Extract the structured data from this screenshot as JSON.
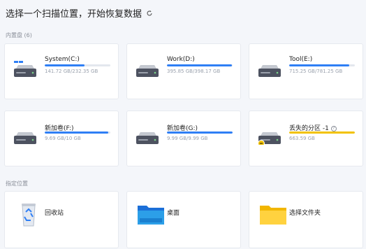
{
  "header": {
    "title": "选择一个扫描位置，开始恢复数据",
    "refresh_icon": "refresh-icon"
  },
  "sections": {
    "drives_label": "内置盘",
    "drives_count": "(6)",
    "locations_label": "指定位置"
  },
  "colors": {
    "accent": "#2f7ff5",
    "lost_partition": "#f2c200",
    "bar_track": "#e3e7ee"
  },
  "drives": [
    {
      "name": "System(C:)",
      "size": "141.72 GB/232.35 GB",
      "usage": 0.61,
      "icon": "windows-drive-icon"
    },
    {
      "name": "Work(D:)",
      "size": "395.85 GB/398.17 GB",
      "usage": 0.99,
      "icon": "hard-drive-icon"
    },
    {
      "name": "Tool(E:)",
      "size": "715.25 GB/781.25 GB",
      "usage": 0.92,
      "icon": "hard-drive-icon"
    },
    {
      "name": "新加卷(F:)",
      "size": "9.69 GB/10 GB",
      "usage": 0.97,
      "icon": "hard-drive-icon"
    },
    {
      "name": "新加卷(G:)",
      "size": "9.99 GB/9.99 GB",
      "usage": 1.0,
      "icon": "hard-drive-icon"
    },
    {
      "name": "丢失的分区 -1",
      "size": "663.59 GB",
      "usage": 1.0,
      "icon": "lost-partition-drive-icon",
      "help_icon": "help-icon",
      "help_glyph": "?"
    }
  ],
  "locations": [
    {
      "name": "回收站",
      "icon": "recycle-bin-icon"
    },
    {
      "name": "桌面",
      "icon": "desktop-folder-icon"
    },
    {
      "name": "选择文件夹",
      "icon": "folder-icon"
    }
  ]
}
